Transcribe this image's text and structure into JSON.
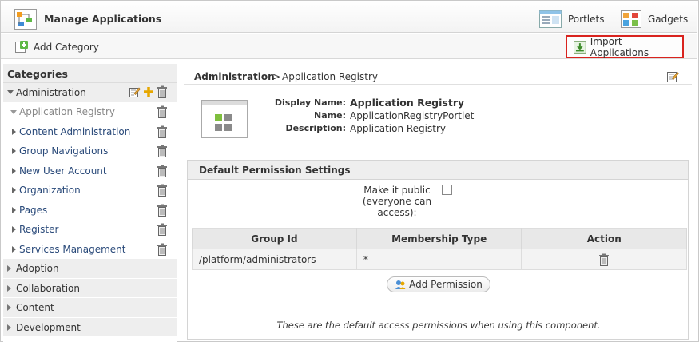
{
  "header": {
    "title": "Manage Applications",
    "portlets_label": "Portlets",
    "gadgets_label": "Gadgets"
  },
  "actions": {
    "add_category_label": "Add Category",
    "import_label": "Import Applications"
  },
  "sidebar": {
    "heading": "Categories",
    "expanded_category": "Administration",
    "sub_items": [
      {
        "label": "Application Registry"
      },
      {
        "label": "Content Administration"
      },
      {
        "label": "Group Navigations"
      },
      {
        "label": "New User Account"
      },
      {
        "label": "Organization"
      },
      {
        "label": "Pages"
      },
      {
        "label": "Register"
      },
      {
        "label": "Services Management"
      }
    ],
    "groups": [
      {
        "label": "Adoption"
      },
      {
        "label": "Collaboration"
      },
      {
        "label": "Content"
      },
      {
        "label": "Development"
      }
    ]
  },
  "breadcrumb": {
    "parent": "Administration",
    "separator": ">",
    "current": "Application Registry"
  },
  "details": {
    "display_name_key": "Display Name:",
    "display_name_value": "Application Registry",
    "name_key": "Name:",
    "name_value": "ApplicationRegistryPortlet",
    "description_key": "Description:",
    "description_value": "Application Registry"
  },
  "permissions": {
    "title": "Default Permission Settings",
    "public_line1": "Make it public",
    "public_line2": "(everyone can",
    "public_line3": "access):",
    "columns": [
      "Group Id",
      "Membership Type",
      "Action"
    ],
    "rows": [
      {
        "group_id": "/platform/administrators",
        "membership": "*"
      }
    ],
    "add_label": "Add Permission",
    "note": "These are the default access permissions when using this component."
  },
  "colors": {
    "highlight_border": "#d9231e",
    "link": "#2a4a7a",
    "panel_bg": "#eeeeee"
  }
}
